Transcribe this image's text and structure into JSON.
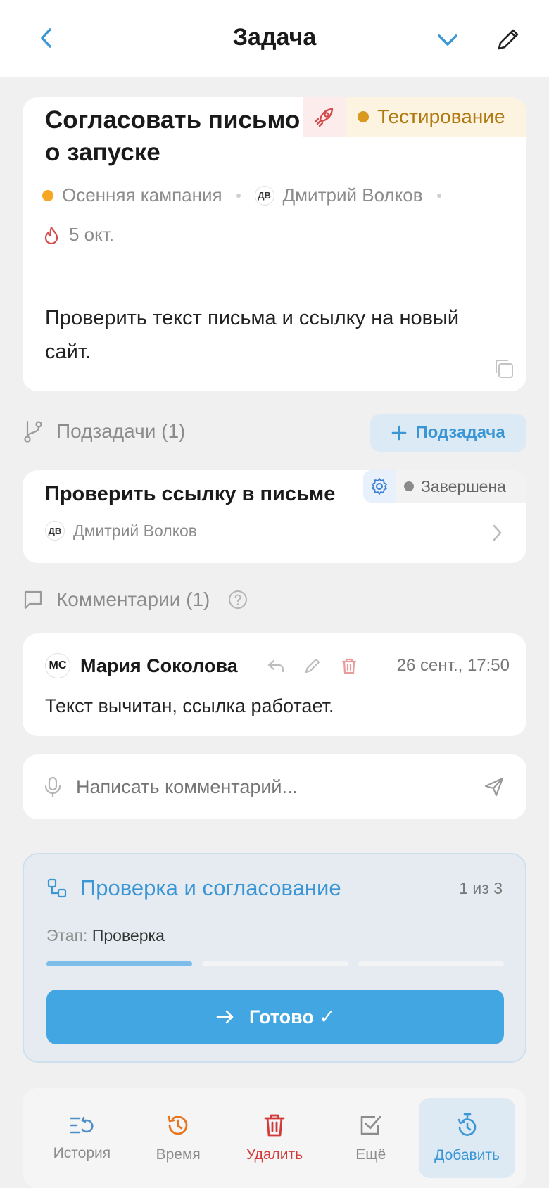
{
  "header": {
    "title": "Задача"
  },
  "task": {
    "title": "Согласовать письмо о запуске",
    "status": "Тестирование",
    "project": "Осенняя кампания",
    "assignee_initials": "ДВ",
    "assignee": "Дмитрий Волков",
    "due": "5 окт.",
    "description": "Проверить текст письма и ссылку на новый сайт."
  },
  "subtasks": {
    "heading": "Подзадачи (1)",
    "add_label": "Подзадача",
    "items": [
      {
        "title": "Проверить ссылку в письме",
        "status": "Завершена",
        "assignee_initials": "ДВ",
        "assignee": "Дмитрий Волков"
      }
    ]
  },
  "comments": {
    "heading": "Комментарии (1)",
    "items": [
      {
        "author_initials": "МС",
        "author": "Мария Соколова",
        "time": "26 сент., 17:50",
        "text": "Текст вычитан, ссылка работает."
      }
    ],
    "input_placeholder": "Написать комментарий..."
  },
  "workflow": {
    "title": "Проверка и согласование",
    "step": "1 из 3",
    "stage_label": "Этап:",
    "stage": "Проверка",
    "progress": {
      "current": 1,
      "total": 3
    },
    "button_label": "Готово ✓"
  },
  "bottom_nav": {
    "history": "История",
    "time": "Время",
    "delete": "Удалить",
    "more": "Ещё",
    "add": "Добавить"
  },
  "colors": {
    "accent": "#41a6e2",
    "status_testing": "#d99a1e",
    "project_dot": "#f5a623",
    "danger": "#d33a3a",
    "time_icon": "#e8741e"
  }
}
